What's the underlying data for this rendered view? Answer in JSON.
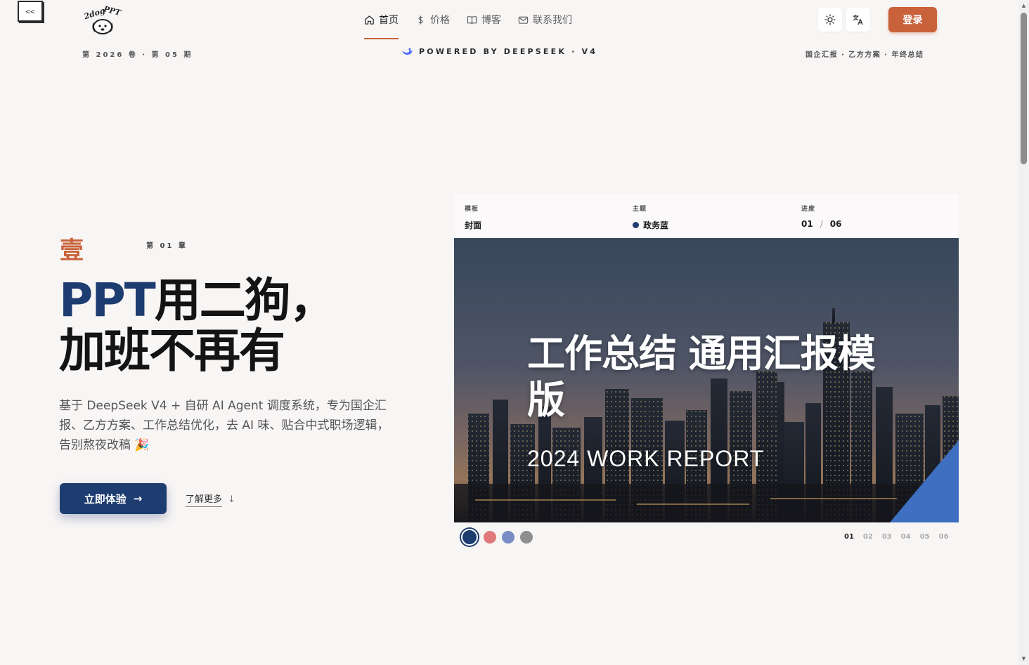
{
  "header": {
    "collapse_label": "<<",
    "logo_text": "2dog PPT",
    "nav": [
      {
        "label": "首页",
        "icon": "home-icon",
        "active": true
      },
      {
        "label": "价格",
        "icon": "dollar-icon",
        "active": false
      },
      {
        "label": "博客",
        "icon": "book-icon",
        "active": false
      },
      {
        "label": "联系我们",
        "icon": "mail-icon",
        "active": false
      }
    ],
    "theme_icon": "sun-icon",
    "lang_icon": "translate-icon",
    "login_label": "登录"
  },
  "meta": {
    "issue": "第 2026 卷 · 第 05 期",
    "powered": "POWERED BY DEEPSEEK · V4",
    "tags": "国企汇报 · 乙方方案 · 年终总结"
  },
  "hero": {
    "chapter_num": "壹",
    "chapter_label": "第 01 章",
    "headline_accent": "PPT",
    "headline_line1_rest": "用二狗，",
    "headline_line2": "加班不再有",
    "description": "基于 DeepSeek V4 + 自研 AI Agent 调度系统，专为国企汇报、乙方方案、工作总结优化，去 AI 味、贴合中式职场逻辑，告别熬夜改稿 🎉",
    "cta_label": "立即体验",
    "cta_arrow": "→",
    "learn_label": "了解更多",
    "learn_arrow": "↓"
  },
  "preview": {
    "template_label": "模板",
    "template_value": "封面",
    "theme_label": "主题",
    "theme_value": "政务蓝",
    "progress_label": "进度",
    "progress_current": "01",
    "progress_sep": "/",
    "progress_total": "06",
    "slide_title": "工作总结 通用汇报模版",
    "slide_subtitle": "2024 WORK REPORT",
    "swatches": [
      "#1d3c70",
      "#e07a7a",
      "#7a8cc4",
      "#8e8e8e"
    ],
    "pages": [
      "01",
      "02",
      "03",
      "04",
      "05",
      "06"
    ]
  },
  "colors": {
    "brand": "#c9623a",
    "primary": "#1d3c70",
    "slide_accent": "#3e6fc0"
  }
}
